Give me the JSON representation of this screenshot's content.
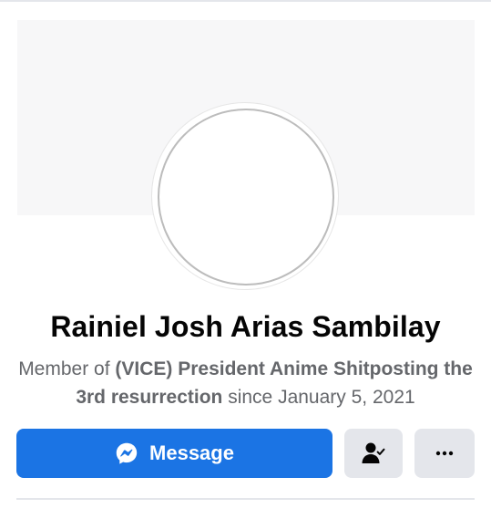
{
  "profile": {
    "name": "Rainiel Josh Arias Sambilay"
  },
  "membership": {
    "prefix": "Member of ",
    "group_name": "(VICE) President Anime Shitposting the 3rd resurrection",
    "since_text": " since January 5, 2021"
  },
  "actions": {
    "message_label": "Message",
    "message_icon": "messenger-icon",
    "friend_icon": "person-check-icon",
    "more_icon": "ellipsis-icon"
  },
  "colors": {
    "primary_blue": "#1b74e4",
    "secondary_button": "#e4e6eb",
    "text_primary": "#050505",
    "text_secondary": "#65676b"
  }
}
